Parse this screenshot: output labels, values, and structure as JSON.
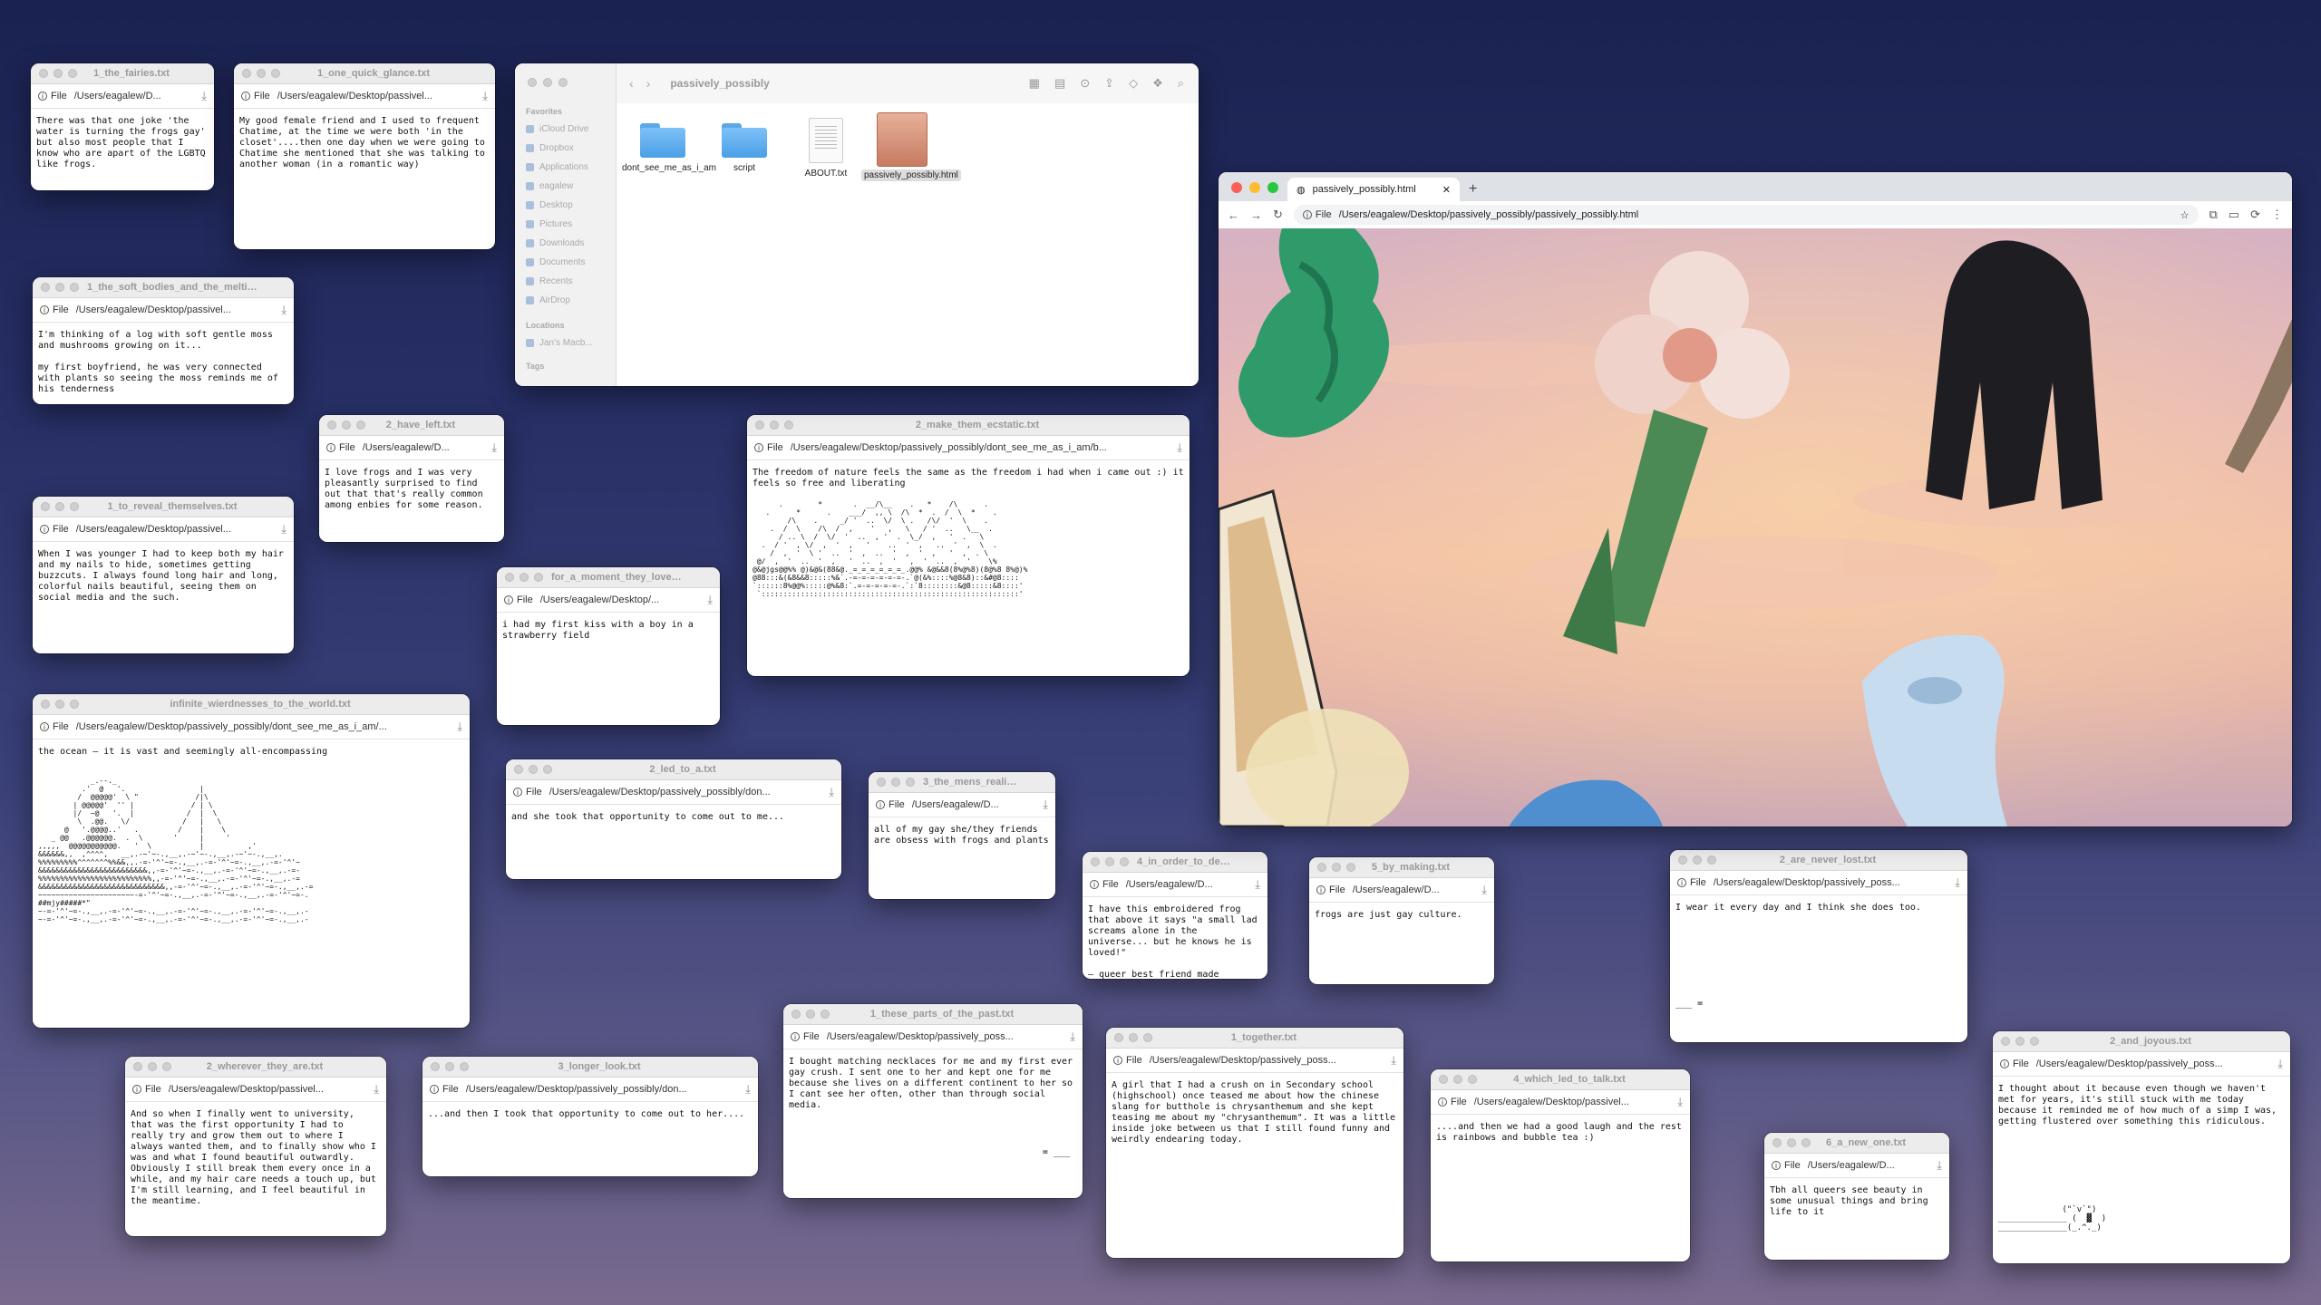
{
  "colors": {
    "close": "#ff5f57",
    "minimize": "#febc2e",
    "zoom": "#28c840",
    "folder": "#4aa0e6"
  },
  "icons": {
    "file": "info-icon",
    "download": "download-icon"
  },
  "file_label": "File",
  "windows": {
    "w1": {
      "title": "1_the_fairies.txt",
      "path": "/Users/eagalew/D...",
      "text": "There was that one joke 'the water is turning the frogs gay' but also most people that I know who are apart of the LGBTQ like frogs."
    },
    "w2": {
      "title": "1_one_quick_glance.txt",
      "path": "/Users/eagalew/Desktop/passivel...",
      "text": "My good female friend and I used to frequent Chatime, at the time we were both 'in the closet'....then one day when we were going to Chatime she mentioned that she was talking to another woman (in a romantic way)"
    },
    "w3": {
      "title": "1_the_soft_bodies_and_the_melting_su...",
      "path": "/Users/eagalew/Desktop/passivel...",
      "text": "I'm thinking of a log with soft gentle moss and mushrooms growing on it...\n\nmy first boyfriend, he was very connected with plants so seeing the moss reminds me of his tenderness"
    },
    "w4": {
      "title": "2_have_left.txt",
      "path": "/Users/eagalew/D...",
      "text": "I love frogs and I was very pleasantly surprised to find out that that's really common among enbies for some reason."
    },
    "w5": {
      "title": "1_to_reveal_themselves.txt",
      "path": "/Users/eagalew/Desktop/passivel...",
      "text": "When I was younger I had to keep both my hair and my nails to hide, sometimes getting buzzcuts. I always found long hair and long, colorful nails beautiful, seeing them on social media and the such."
    },
    "w6": {
      "title": "for_a_moment_they_love_each_...",
      "path": "/Users/eagalew/Desktop/...",
      "text": "i had my first kiss with a boy in a strawberry field"
    },
    "w7": {
      "title": "2_make_them_ecstatic.txt",
      "path": "/Users/eagalew/Desktop/passively_possibly/dont_see_me_as_i_am/b...",
      "text": "The freedom of nature feels the same as the freedom i had when i came out :) it feels so free and liberating"
    },
    "w8": {
      "title": "infinite_wierdnesses_to_the_world.txt",
      "path": "/Users/eagalew/Desktop/passively_possibly/dont_see_me_as_i_am/...",
      "text": "the ocean – it is vast and seemingly all-encompassing"
    },
    "w9": {
      "title": "2_led_to_a.txt",
      "path": "/Users/eagalew/Desktop/passively_possibly/don...",
      "text": "and she took that opportunity to come out to me..."
    },
    "w10": {
      "title": "3_the_mens_reality.txt",
      "path": "/Users/eagalew/D...",
      "text": "all of my gay she/they friends are obsess with frogs and plants"
    },
    "w11": {
      "title": "4_in_order_to_destroy_it...",
      "path": "/Users/eagalew/D...",
      "text": "I have this embroidered frog that above it says \"a small lad screams alone in the universe... but he knows he is loved!\"\n\n— queer best friend made"
    },
    "w12": {
      "title": "5_by_making.txt",
      "path": "/Users/eagalew/D...",
      "text": "frogs are just gay culture."
    },
    "w13": {
      "title": "2_are_never_lost.txt",
      "path": "/Users/eagalew/Desktop/passively_poss...",
      "text": "I wear it every day and I think she does too."
    },
    "w14": {
      "title": "2_wherever_they_are.txt",
      "path": "/Users/eagalew/Desktop/passivel...",
      "text": "And so when I finally went to university, that was the first opportunity I had to really try and grow them out to where I always wanted them, and to finally show who I was and what I found beautiful outwardly. Obviously I still break them every once in a while, and my hair care needs a touch up, but I'm still learning, and I feel beautiful in the meantime."
    },
    "w15": {
      "title": "3_longer_look.txt",
      "path": "/Users/eagalew/Desktop/passively_possibly/don...",
      "text": "...and then I took that opportunity to come out to her...."
    },
    "w16": {
      "title": "1_these_parts_of_the_past.txt",
      "path": "/Users/eagalew/Desktop/passively_poss...",
      "text": "I bought matching necklaces for me and my first ever gay crush. I sent one to her and kept one for me because she lives on a different continent to her so I cant see her often, other than through social media."
    },
    "w17": {
      "title": "1_together.txt",
      "path": "/Users/eagalew/Desktop/passively_poss...",
      "text": "A girl that I had a crush on in Secondary school (highschool) once teased me about how the chinese slang for butthole is chrysanthemum and she kept teasing me about my \"chrysanthemum\". It was a little inside joke between us that I still found funny and weirdly endearing today."
    },
    "w18": {
      "title": "4_which_led_to_talk.txt",
      "path": "/Users/eagalew/Desktop/passivel...",
      "text": "....and then we had a good laugh and the rest is rainbows and bubble tea :)"
    },
    "w19": {
      "title": "6_a_new_one.txt",
      "path": "/Users/eagalew/D...",
      "text": "Tbh all queers see beauty in some unusual things and bring life to it"
    },
    "w20": {
      "title": "2_and_joyous.txt",
      "path": "/Users/eagalew/Desktop/passively_poss...",
      "text": "I thought about it because even though we haven't met for years, it's still stuck with me today because it reminded me of how much of a simp I was, getting flustered over something this ridiculous."
    }
  },
  "finder": {
    "title": "passively_possibly",
    "sidebar_heading": "Favorites",
    "sidebar_items": [
      "iCloud Drive",
      "Dropbox",
      "Applications",
      "eagalew",
      "Desktop",
      "Pictures",
      "Downloads",
      "Documents",
      "Recents",
      "AirDrop"
    ],
    "locations_heading": "Locations",
    "location_item": "Jan's Macb...",
    "tags_heading": "Tags",
    "items": [
      "dont_see_me_as_i_am",
      "script",
      "ABOUT.txt",
      "passively_possibly.html"
    ]
  },
  "browser": {
    "tab_title": "passively_possibly.html",
    "url": "/Users/eagalew/Desktop/passively_possibly/passively_possibly.html"
  }
}
